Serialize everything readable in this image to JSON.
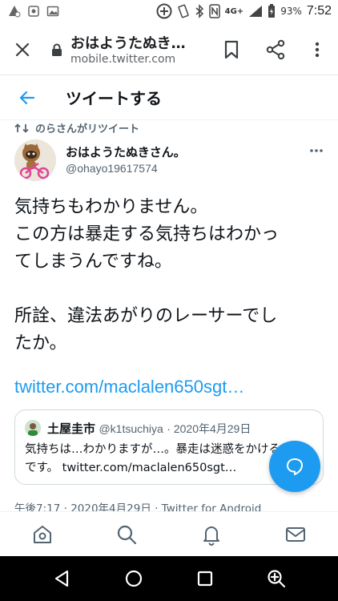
{
  "status_bar": {
    "battery_percent": "93%",
    "network": "4G+",
    "time": "7:52"
  },
  "browser": {
    "page_title": "おはようたぬき…",
    "domain": "mobile.twitter.com"
  },
  "header": {
    "title": "ツイートする"
  },
  "tweet": {
    "retweet_label": "のらさんがリツイート",
    "author_name": "おはようたぬきさん。",
    "author_handle": "@ohayo19617574",
    "text": "気持ちもわかりません。\nこの方は暴走する気持ちはわかっ\nてしまうんですね。\n\n所詮、違法あがりのレーサーでし\nたか。",
    "link": "twitter.com/maclalen650sgt…",
    "quote": {
      "author_name": "土屋圭市",
      "author_handle": "@k1tsuchiya",
      "date": "· 2020年4月29日",
      "text": "気持ちは…わかりますが…。暴走は迷惑をかけるだけです。 twitter.com/maclalen650sgt…"
    },
    "meta": "午後7:17 · 2020年4月29日 · Twitter for Android"
  },
  "colors": {
    "accent": "#1d9bf0",
    "secondary_text": "#536471",
    "border": "#cfd9de",
    "system_nav": "#000000"
  },
  "icons": {
    "fab": "reply-icon",
    "bottom_nav": [
      "home-icon",
      "search-icon",
      "notifications-icon",
      "messages-icon"
    ]
  }
}
